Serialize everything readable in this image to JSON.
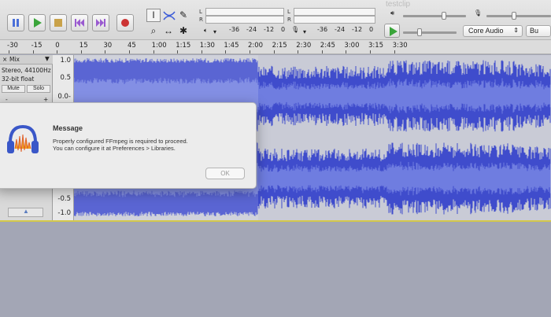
{
  "window": {
    "title": "testclip"
  },
  "transport": {
    "pause": "pause-icon",
    "play": "play-icon",
    "stop": "stop-icon",
    "skip_start": "skip-to-start-icon",
    "skip_end": "skip-to-end-icon",
    "record": "record-icon"
  },
  "tools": {
    "selection": "I",
    "zoom": "⌕",
    "timeshift": "↔",
    "multi": "✱",
    "draw": "✎"
  },
  "meters": {
    "playback_ticks": [
      "-36",
      "-24",
      "-12",
      "0"
    ],
    "record_ticks": [
      "-36",
      "-24",
      "-12",
      "0"
    ],
    "lr": [
      "L",
      "R"
    ]
  },
  "device": {
    "host": "Core Audio",
    "next": "Bu"
  },
  "ruler": {
    "labels": [
      "-30",
      "-15",
      "0",
      "15",
      "30",
      "45",
      "1:00",
      "1:15",
      "1:30",
      "1:45",
      "2:00",
      "2:15",
      "2:30",
      "2:45",
      "3:00",
      "3:15",
      "3:30"
    ]
  },
  "track": {
    "name": "Mix",
    "format": "Stereo, 44100Hz",
    "bits": "32-bit float",
    "mute": "Mute",
    "solo": "Solo",
    "gain_minus": "-",
    "gain_plus": "+",
    "close": "×"
  },
  "vscale": {
    "labels": [
      "1.0",
      "0.5",
      "0.0-",
      "-0.5",
      "-1.0"
    ]
  },
  "dialog": {
    "title": "Message",
    "line1": "Properly configured FFmpeg is required to proceed.",
    "line2": "You can configure it at Preferences > Libraries.",
    "ok": "OK"
  },
  "colors": {
    "wave": "#3f4ccc",
    "wave_light": "#6f7de0",
    "selection_bg": "#c9cbd6",
    "accent_play": "#3aa53a",
    "record": "#cc3333"
  }
}
